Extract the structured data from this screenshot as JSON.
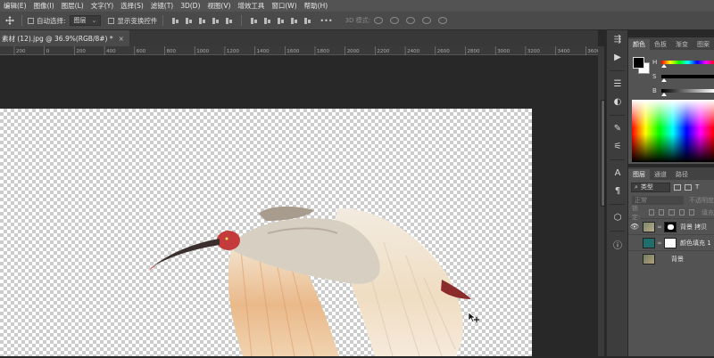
{
  "menu": [
    "编辑(E)",
    "图像(I)",
    "图层(L)",
    "文字(Y)",
    "选择(S)",
    "滤镜(T)",
    "3D(D)",
    "视图(V)",
    "增效工具",
    "窗口(W)",
    "帮助(H)"
  ],
  "options": {
    "auto_select_label": "自动选择:",
    "auto_select_value": "图层",
    "show_transform_label": "显示变换控件",
    "mode_3d_label": "3D 模式:"
  },
  "document": {
    "tab_title": "素材 (12).jpg @ 36.9%(RGB/8#) *",
    "close_glyph": "×"
  },
  "ruler_ticks": [
    "200",
    "0",
    "200",
    "400",
    "600",
    "800",
    "1000",
    "1200",
    "1400",
    "1600",
    "1800",
    "2000",
    "2200",
    "2400",
    "2600",
    "2800",
    "3000",
    "3200",
    "3400",
    "3600"
  ],
  "color_panel": {
    "tabs": [
      "颜色",
      "色板",
      "渐变",
      "图案"
    ],
    "active_tab": "颜色",
    "foreground": "#000000",
    "background": "#ffffff",
    "sliders": [
      {
        "label": "H",
        "value": 0
      },
      {
        "label": "S",
        "value": 0
      },
      {
        "label": "B",
        "value": 0
      }
    ]
  },
  "layers_panel": {
    "tabs": [
      "图层",
      "通道",
      "路径"
    ],
    "active_tab": "图层",
    "kind_filter": "类型",
    "blend_mode": "正常",
    "opacity_label": "不透明度",
    "lock_label": "锁定:",
    "fill_label": "填充",
    "layers": [
      {
        "name": "背景 拷贝",
        "visible": true,
        "selected": false,
        "thumb": "bird",
        "has_mask": true
      },
      {
        "name": "颜色填充 1",
        "visible": false,
        "selected": false,
        "thumb": "teal",
        "has_mask": true
      },
      {
        "name": "背景",
        "visible": false,
        "selected": false,
        "thumb": "bird",
        "has_mask": false
      }
    ]
  }
}
